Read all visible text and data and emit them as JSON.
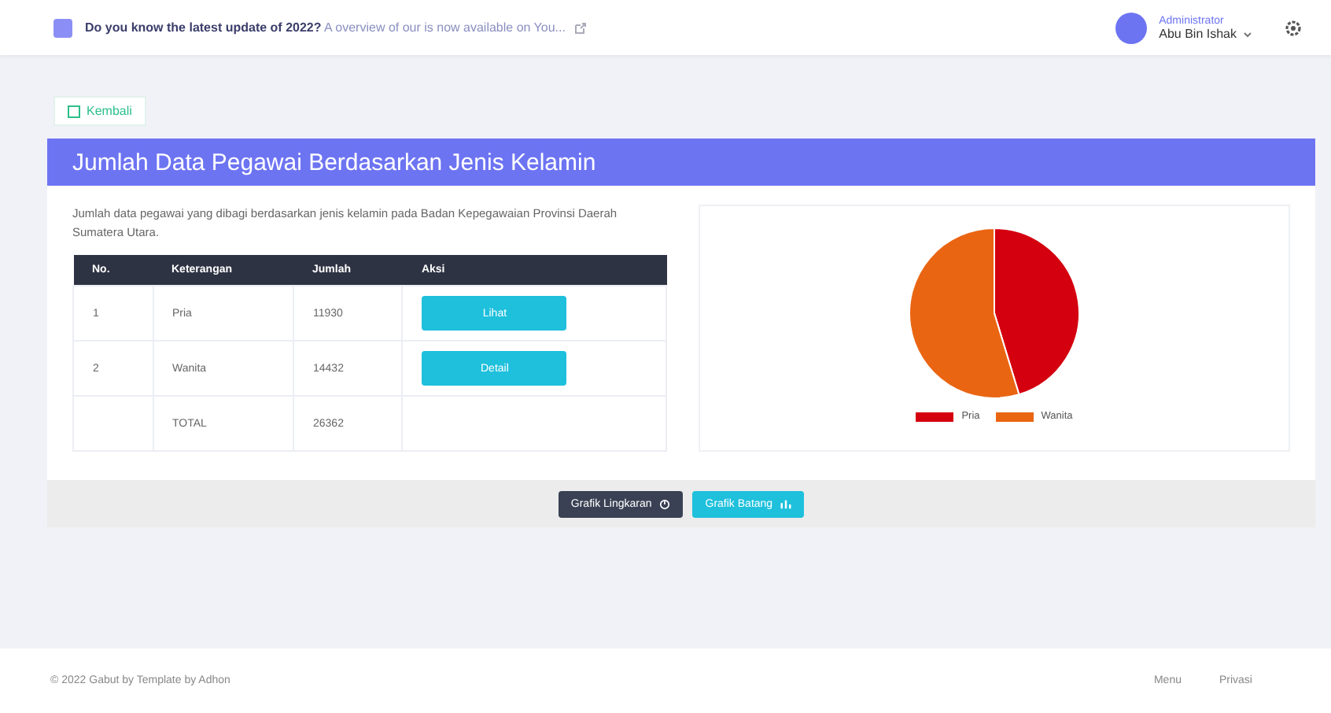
{
  "topbar": {
    "notice": "**Do you know the latest update of 2022?** A overview of our is now available on You...",
    "user_role": "Administrator",
    "user_name": "Abu Bin Ishak"
  },
  "back_button": "Kembali",
  "card": {
    "title": "Jumlah Data Pegawai Berdasarkan Jenis Kelamin",
    "description": "Jumlah data pegawai yang dibagi berdasarkan jenis kelamin pada Badan Kepegawaian Provinsi Daerah Sumatera Utara.",
    "table": {
      "columns": [
        "No.",
        "Keterangan",
        "Jumlah",
        "Aksi"
      ],
      "rows": [
        {
          "no": "1",
          "label": "Pria",
          "count": "11930",
          "action": "Lihat"
        },
        {
          "no": "2",
          "label": "Wanita",
          "count": "14432",
          "action": "Detail"
        }
      ],
      "total": {
        "label": "TOTAL",
        "count": "26362"
      }
    },
    "chart_data": {
      "type": "pie",
      "categories": [
        "Pria",
        "Wanita"
      ],
      "values": [
        45.3,
        54.7
      ],
      "legend": "bottom",
      "colors": [
        "#d4000f",
        "#ea6512"
      ]
    },
    "buttons": [
      {
        "label": "Grafik Lingkaran",
        "kind": "dark"
      },
      {
        "label": "Grafik Batang",
        "kind": "info"
      }
    ]
  },
  "footer": {
    "copyright": "© 2022 Gabut by Template by Adhon",
    "links": [
      "Menu",
      "Privasi"
    ]
  }
}
